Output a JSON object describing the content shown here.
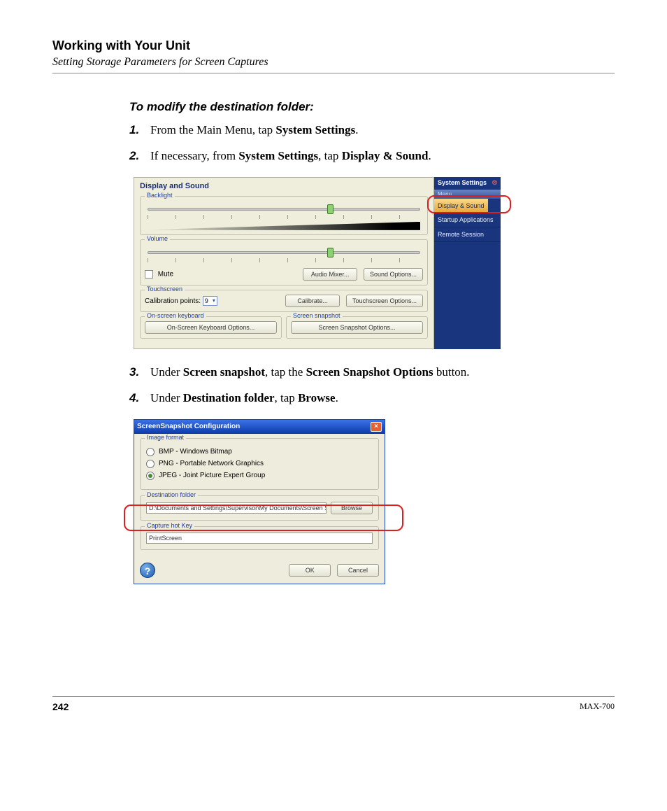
{
  "header": {
    "title": "Working with Your Unit",
    "subtitle": "Setting Storage Parameters for Screen Captures"
  },
  "procedure": {
    "title": "To modify the destination folder:",
    "steps": {
      "s1_a": "From the Main Menu, tap ",
      "s1_b": "System Settings",
      "s1_c": ".",
      "s2_a": "If necessary, from ",
      "s2_b": "System Settings",
      "s2_c": ", tap ",
      "s2_d": "Display & Sound",
      "s2_e": ".",
      "s3_a": "Under ",
      "s3_b": "Screen snapshot",
      "s3_c": ", tap the ",
      "s3_d": "Screen Snapshot Options",
      "s3_e": " button.",
      "s4_a": "Under ",
      "s4_b": "Destination folder",
      "s4_c": ", tap ",
      "s4_d": "Browse",
      "s4_e": "."
    },
    "nums": {
      "n1": "1.",
      "n2": "2.",
      "n3": "3.",
      "n4": "4."
    }
  },
  "shot1": {
    "title": "Display and Sound",
    "backlight": "Backlight",
    "volume": "Volume",
    "mute": "Mute",
    "audio_mixer": "Audio Mixer...",
    "sound_options": "Sound Options...",
    "touchscreen": "Touchscreen",
    "calibration_points": "Calibration points:",
    "calibration_value": "9",
    "calibrate": "Calibrate...",
    "touchscreen_options": "Touchscreen Options...",
    "onscreen_kb": "On-screen keyboard",
    "onscreen_kb_btn": "On-Screen Keyboard Options...",
    "screen_snapshot": "Screen snapshot",
    "screen_snapshot_btn": "Screen Snapshot Options...",
    "side": {
      "title": "System Settings",
      "menu": "Menu",
      "item1": "Display & Sound",
      "item2": "Startup Applications",
      "item3": "Remote Session"
    }
  },
  "shot2": {
    "title": "ScreenSnapshot Configuration",
    "image_format": "Image format",
    "bmp": "BMP - Windows Bitmap",
    "png": "PNG - Portable Network Graphics",
    "jpeg": "JPEG - Joint Picture Expert Group",
    "dest_folder": "Destination folder",
    "path": "D:\\Documents and Settings\\Supervisor\\My Documents\\Screen Snap",
    "browse": "Browse",
    "capture_hotkey": "Capture hot Key",
    "hotkey_value": "PrintScreen",
    "ok": "OK",
    "cancel": "Cancel",
    "help": "?"
  },
  "footer": {
    "page": "242",
    "model": "MAX-700"
  }
}
